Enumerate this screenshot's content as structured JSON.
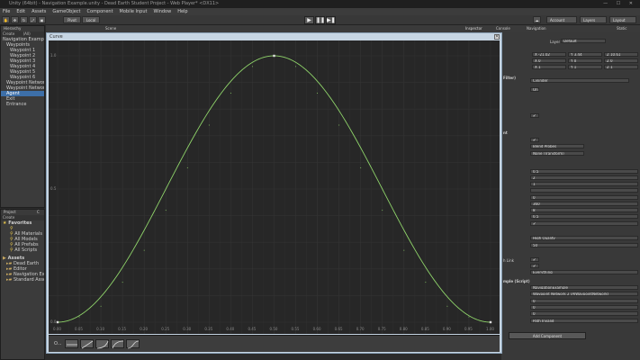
{
  "window": {
    "title": "Unity (64bit) - Navigation Example.unity - Dead Earth Student Project - Web Player* <DX11>",
    "controls": "— ☐ ✕"
  },
  "menu": [
    "File",
    "Edit",
    "Assets",
    "GameObject",
    "Component",
    "Mobile Input",
    "Window",
    "Help"
  ],
  "toolbar": {
    "pivot_label": "Pivot",
    "local_label": "Local",
    "play_icons": [
      "▶",
      "❚❚",
      "▶❚"
    ],
    "account_label": "Account",
    "layers_label": "Layers",
    "layout_label": "Layout"
  },
  "tabs": {
    "hierarchy": "Hierarchy",
    "scene": "Scene",
    "inspector": "Inspector",
    "console": "Console",
    "navigation": "Navigation",
    "static": "Static"
  },
  "hierarchy": {
    "create": "Create",
    "search": "(All)",
    "items": [
      {
        "label": "Navigation Example",
        "indent": 0
      },
      {
        "label": "Waypoints",
        "indent": 1
      },
      {
        "label": "Waypoint 1",
        "indent": 2
      },
      {
        "label": "Waypoint 2",
        "indent": 2
      },
      {
        "label": "Waypoint 3",
        "indent": 2
      },
      {
        "label": "Waypoint 4",
        "indent": 2
      },
      {
        "label": "Waypoint 5",
        "indent": 2
      },
      {
        "label": "Waypoint 6",
        "indent": 2
      },
      {
        "label": "Waypoint Network 1",
        "indent": 1
      },
      {
        "label": "Waypoint Network 2",
        "indent": 1
      },
      {
        "label": "Agent",
        "indent": 1,
        "selected": true
      },
      {
        "label": "Exit",
        "indent": 1
      },
      {
        "label": "Entrance",
        "indent": 1
      }
    ]
  },
  "project": {
    "tab": "Project",
    "tab2": "C",
    "create": "Create",
    "favorites_label": "Favorites",
    "favorites": [
      "All Materials",
      "All Models",
      "All Prefabs",
      "All Scripts"
    ],
    "assets_label": "Assets",
    "assets": [
      "Dead Earth",
      "Editor",
      "Navigation Example",
      "Standard Assets"
    ]
  },
  "inspector": {
    "layer_label": "Layer",
    "layer_value": "Default",
    "row_xyz_1": [
      "X -21.02",
      "Y 3.44",
      "Z 10.61"
    ],
    "row_xyz_2": [
      "X 0",
      "Y 0",
      "Z 0"
    ],
    "row_xyz_3": [
      "X 1",
      "Y 1",
      "Z 1"
    ],
    "filter_header": "Filter)",
    "filter_value": "Cylinder",
    "fields": [
      {
        "text": "On"
      },
      {
        "text": "✔"
      },
      {
        "text": "✔"
      },
      {
        "text": "Blend Probes"
      },
      {
        "text": "None (Transform)"
      }
    ],
    "nav_header": "nt",
    "nav_fields": [
      "0.5",
      "2",
      "1",
      "",
      "0",
      "360",
      "8",
      "0.5",
      "✔"
    ],
    "quality": "High Quality",
    "priority": "50",
    "link_label": "h Link",
    "link_fields": [
      "✔",
      "✔",
      "Everything"
    ],
    "script_header": "mple (Script)",
    "script_fields": [
      "NavigationExample",
      "Waypoint Network 2 (AIWaypointNetwork)",
      "0",
      "0",
      "0",
      "Path Invalid"
    ],
    "add_component": "Add Component"
  },
  "curve_window": {
    "title": "Curve",
    "y_ticks": [
      "1.0",
      "0.5",
      "0.0"
    ],
    "x_ticks": [
      "0.00",
      "0.05",
      "0.10",
      "0.15",
      "0.20",
      "0.25",
      "0.30",
      "0.35",
      "0.40",
      "0.45",
      "0.50",
      "0.55",
      "0.60",
      "0.65",
      "0.70",
      "0.75",
      "0.80",
      "0.85",
      "0.90",
      "0.95",
      "1.00"
    ],
    "presets_label": "O..."
  },
  "chart_data": {
    "type": "line",
    "xlim": [
      0,
      1
    ],
    "ylim": [
      0,
      1
    ],
    "grid": true,
    "series": [
      {
        "x": [
          0,
          0.05,
          0.1,
          0.15,
          0.2,
          0.25,
          0.3,
          0.35,
          0.4,
          0.45,
          0.5,
          0.55,
          0.6,
          0.65,
          0.7,
          0.75,
          0.8,
          0.85,
          0.9,
          0.95,
          1.0
        ],
        "y": [
          0,
          0.02,
          0.06,
          0.15,
          0.27,
          0.42,
          0.58,
          0.74,
          0.86,
          0.96,
          1.0,
          0.96,
          0.86,
          0.74,
          0.58,
          0.42,
          0.27,
          0.15,
          0.06,
          0.02,
          0
        ]
      }
    ],
    "keys": [
      {
        "x": 0,
        "y": 0
      },
      {
        "x": 0.5,
        "y": 1
      },
      {
        "x": 1,
        "y": 0
      }
    ],
    "curve_color": "#8fd46a"
  }
}
